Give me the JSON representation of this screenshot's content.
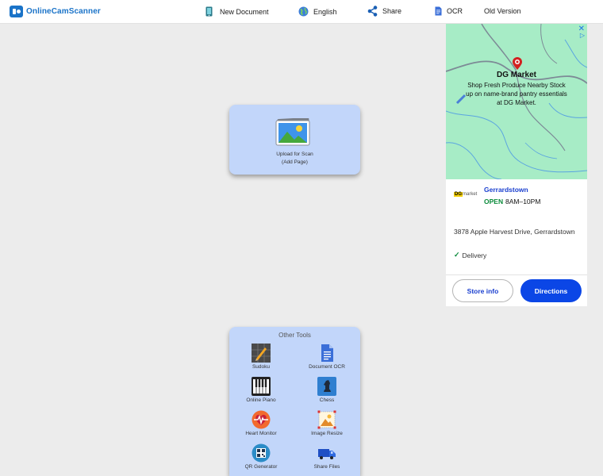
{
  "header": {
    "logo_text": "OnlineCamScanner",
    "nav": {
      "new_document": "New Document",
      "language": "English",
      "share": "Share",
      "ocr": "OCR",
      "old_version": "Old Version"
    }
  },
  "upload": {
    "line1": "Upload for Scan",
    "line2": "(Add Page)"
  },
  "tools": {
    "title": "Other Tools",
    "items": [
      {
        "label": "Sudoku",
        "icon": "sudoku-icon"
      },
      {
        "label": "Document OCR",
        "icon": "document-ocr-icon"
      },
      {
        "label": "Online Piano",
        "icon": "piano-icon"
      },
      {
        "label": "Chess",
        "icon": "chess-icon"
      },
      {
        "label": "Heart Monitor",
        "icon": "heart-monitor-icon"
      },
      {
        "label": "Image Resize",
        "icon": "image-resize-icon"
      },
      {
        "label": "QR Generator",
        "icon": "qr-generator-icon"
      },
      {
        "label": "Share Files",
        "icon": "share-files-icon"
      }
    ]
  },
  "ad": {
    "brand": "DG Market",
    "desc": "Shop Fresh Produce Nearby Stock up on name-brand pantry essentials at DG Market.",
    "logo_dg": "DG",
    "logo_market": "market",
    "store_name": "Gerrardstown",
    "status": "OPEN",
    "hours": "8AM–10PM",
    "address": "3878 Apple Harvest Drive, Gerrardstown",
    "delivery": "Delivery",
    "store_info_label": "Store info",
    "directions_label": "Directions",
    "close_glyph": "✕",
    "adchoices_glyph": "▷"
  },
  "colors": {
    "brand": "#1a73c8",
    "card": "#c2d6fa",
    "map": "#a7ecc6",
    "directions": "#0b46e6",
    "open": "#0a8a3a"
  }
}
